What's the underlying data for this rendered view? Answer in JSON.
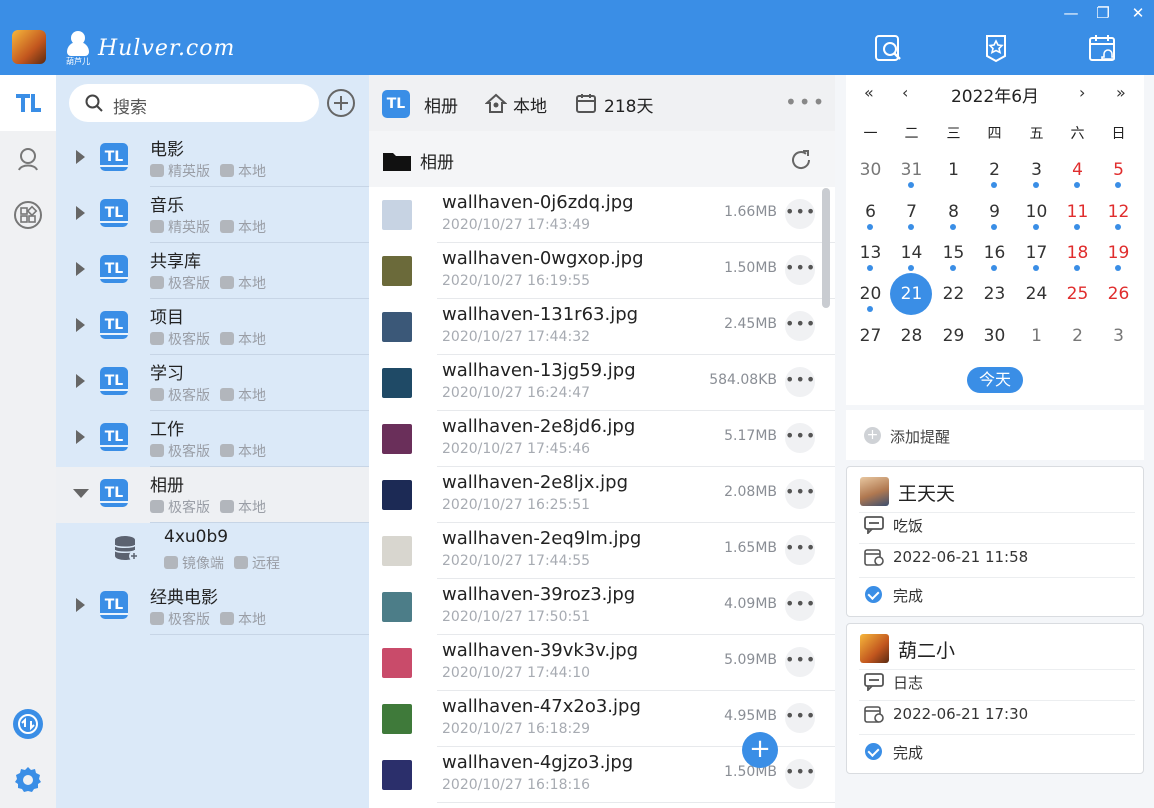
{
  "brand": {
    "name": "Hulver.com",
    "sub": "葫芦儿"
  },
  "window": {
    "minimize": "—",
    "restore": "❐",
    "close": "✕"
  },
  "search": {
    "placeholder": "搜索"
  },
  "libraries": [
    {
      "name": "电影",
      "edition": "精英版",
      "location": "本地"
    },
    {
      "name": "音乐",
      "edition": "精英版",
      "location": "本地"
    },
    {
      "name": "共享库",
      "edition": "极客版",
      "location": "本地"
    },
    {
      "name": "项目",
      "edition": "极客版",
      "location": "本地"
    },
    {
      "name": "学习",
      "edition": "极客版",
      "location": "本地"
    },
    {
      "name": "工作",
      "edition": "极客版",
      "location": "本地"
    },
    {
      "name": "相册",
      "edition": "极客版",
      "location": "本地",
      "expanded": true
    },
    {
      "name": "4xu0b9",
      "edition": "镜像端",
      "location": "远程",
      "child": true
    },
    {
      "name": "经典电影",
      "edition": "极客版",
      "location": "本地"
    }
  ],
  "files_header": {
    "library": "相册",
    "location": "本地",
    "days": "218天",
    "more": "•••"
  },
  "folder": {
    "name": "相册"
  },
  "files": [
    {
      "name": "wallhaven-0j6zdq.jpg",
      "date": "2020/10/27 17:43:49",
      "size": "1.66MB",
      "thumb_color": "#c7d3e3"
    },
    {
      "name": "wallhaven-0wgxop.jpg",
      "date": "2020/10/27 16:19:55",
      "size": "1.50MB",
      "thumb_color": "#6b6a3a"
    },
    {
      "name": "wallhaven-131r63.jpg",
      "date": "2020/10/27 17:44:32",
      "size": "2.45MB",
      "thumb_color": "#3b5878"
    },
    {
      "name": "wallhaven-13jg59.jpg",
      "date": "2020/10/27 16:24:47",
      "size": "584.08KB",
      "thumb_color": "#1f4a66"
    },
    {
      "name": "wallhaven-2e8jd6.jpg",
      "date": "2020/10/27 17:45:46",
      "size": "5.17MB",
      "thumb_color": "#6a2f5a"
    },
    {
      "name": "wallhaven-2e8ljx.jpg",
      "date": "2020/10/27 16:25:51",
      "size": "2.08MB",
      "thumb_color": "#1c2a55"
    },
    {
      "name": "wallhaven-2eq9lm.jpg",
      "date": "2020/10/27 17:44:55",
      "size": "1.65MB",
      "thumb_color": "#d8d6cf"
    },
    {
      "name": "wallhaven-39roz3.jpg",
      "date": "2020/10/27 17:50:51",
      "size": "4.09MB",
      "thumb_color": "#4c7d88"
    },
    {
      "name": "wallhaven-39vk3v.jpg",
      "date": "2020/10/27 17:44:10",
      "size": "5.09MB",
      "thumb_color": "#c94b6a"
    },
    {
      "name": "wallhaven-47x2o3.jpg",
      "date": "2020/10/27 16:18:29",
      "size": "4.95MB",
      "thumb_color": "#3f7a3a"
    },
    {
      "name": "wallhaven-4gjzo3.jpg",
      "date": "2020/10/27 16:18:16",
      "size": "1.50MB",
      "thumb_color": "#2b2f6b"
    }
  ],
  "calendar": {
    "nav": {
      "prev_year": "«",
      "prev_month": "‹",
      "next_month": "›",
      "next_year": "»"
    },
    "title": "2022年6月",
    "weekdays": [
      "一",
      "二",
      "三",
      "四",
      "五",
      "六",
      "日"
    ],
    "rows": [
      [
        "30",
        "31",
        "1",
        "2",
        "3",
        "4",
        "5"
      ],
      [
        "6",
        "7",
        "8",
        "9",
        "10",
        "11",
        "12"
      ],
      [
        "13",
        "14",
        "15",
        "16",
        "17",
        "18",
        "19"
      ],
      [
        "20",
        "21",
        "22",
        "23",
        "24",
        "25",
        "26"
      ],
      [
        "27",
        "28",
        "29",
        "30",
        "1",
        "2",
        "3"
      ]
    ],
    "today_button": "今天",
    "accent": "#3a8ee6",
    "weekend_color": "#e02d2d"
  },
  "reminders": {
    "add_label": "添加提醒",
    "items": [
      {
        "name": "王天天",
        "content": "吃饭",
        "time": "2022-06-21 11:58",
        "status": "完成"
      },
      {
        "name": "葫二小",
        "content": "日志",
        "time": "2022-06-21 17:30",
        "status": "完成"
      }
    ]
  }
}
